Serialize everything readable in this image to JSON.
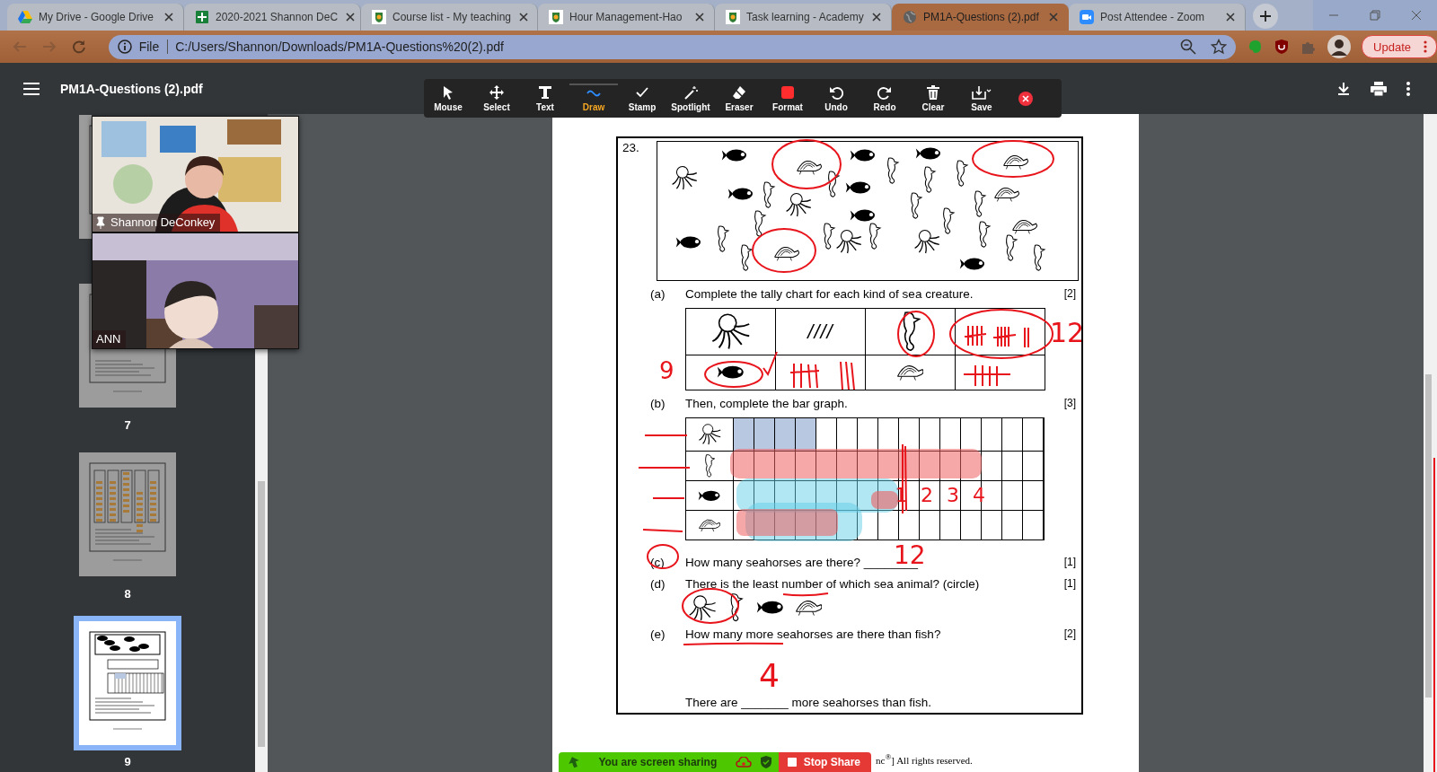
{
  "browser": {
    "tabs": [
      {
        "title": "My Drive - Google Drive",
        "selected": false
      },
      {
        "title": "2020-2021 Shannon DeC",
        "selected": false
      },
      {
        "title": "Course list - My teaching",
        "selected": false
      },
      {
        "title": "Hour Management-Hao",
        "selected": false
      },
      {
        "title": "Task learning - Academy",
        "selected": false
      },
      {
        "title": "PM1A-Questions (2).pdf",
        "selected": true
      },
      {
        "title": "Post Attendee - Zoom",
        "selected": false
      }
    ],
    "address": {
      "scheme": "File",
      "url": "C:/Users/Shannon/Downloads/PM1A-Questions%20(2).pdf"
    },
    "update_button": "Update"
  },
  "viewer": {
    "title": "PM1A-Questions (2).pdf"
  },
  "annotate_toolbar": {
    "tools": [
      {
        "label": "Mouse",
        "selected": false
      },
      {
        "label": "Select",
        "selected": false
      },
      {
        "label": "Text",
        "selected": false
      },
      {
        "label": "Draw",
        "selected": true
      },
      {
        "label": "Stamp",
        "selected": false
      },
      {
        "label": "Spotlight",
        "selected": false
      },
      {
        "label": "Eraser",
        "selected": false
      },
      {
        "label": "Format",
        "selected": false
      },
      {
        "label": "Undo",
        "selected": false
      },
      {
        "label": "Redo",
        "selected": false
      },
      {
        "label": "Clear",
        "selected": false
      },
      {
        "label": "Save",
        "selected": false
      }
    ]
  },
  "thumbnails": [
    {
      "selected": false
    },
    {
      "page": "7",
      "selected": false
    },
    {
      "page": "8",
      "selected": false
    },
    {
      "page": "9",
      "selected": true
    }
  ],
  "video": {
    "participants": [
      {
        "name": "Shannon DeConkey",
        "pinned": true
      },
      {
        "name": "ANN",
        "pinned": false
      }
    ]
  },
  "question": {
    "number": "23.",
    "parts": [
      {
        "kind": "prompt",
        "label": "(a)",
        "text": "Complete the tally chart for each kind of sea creature.",
        "marks": "[2]"
      },
      {
        "kind": "tally_chart",
        "rows": [
          {
            "handwritten": "12",
            "cells": [
              {
                "kind": "octopus"
              },
              {
                "kind": "tally",
                "text": "////"
              },
              {
                "kind": "seahorse"
              },
              {
                "kind": "blank"
              }
            ]
          },
          {
            "handwritten": "9",
            "cells": [
              {
                "kind": "fish"
              },
              {
                "kind": "blank"
              },
              {
                "kind": "turtle"
              },
              {
                "kind": "blank"
              }
            ]
          }
        ]
      },
      {
        "kind": "prompt",
        "label": "(b)",
        "text": "Then, complete the bar graph.",
        "marks": "[3]"
      },
      {
        "kind": "bar_graph",
        "rows": [
          {
            "kind": "octopus",
            "level": 0.267
          },
          {
            "kind": "seahorse",
            "level": 0
          },
          {
            "kind": "fish",
            "level": 0,
            "handwritten": "1 2 3 4"
          },
          {
            "kind": "turtle",
            "level": 0
          }
        ]
      },
      {
        "kind": "prompt",
        "label": "(c)",
        "text": "How many seahorses are there? ________",
        "marks": "[1]",
        "answer": "12"
      },
      {
        "kind": "prompt",
        "label": "(d)",
        "text": "There is the least number of which sea animal? (circle)",
        "marks": "[1]"
      },
      {
        "kind": "choices",
        "items": [
          {
            "kind": "octopus"
          },
          {
            "kind": "seahorse"
          },
          {
            "kind": "fish"
          },
          {
            "kind": "turtle"
          }
        ]
      },
      {
        "kind": "prompt",
        "label": "(e)",
        "text": "How many more seahorses are there than fish?",
        "marks": "[2]"
      },
      {
        "kind": "sentence",
        "text": "There are _______ more seahorses than fish.",
        "answer": "4"
      }
    ]
  },
  "footer": "nc$^{®}$] All rights reserved.",
  "share_bar": {
    "status": "You are screen sharing",
    "stop_button": "Stop Share"
  }
}
